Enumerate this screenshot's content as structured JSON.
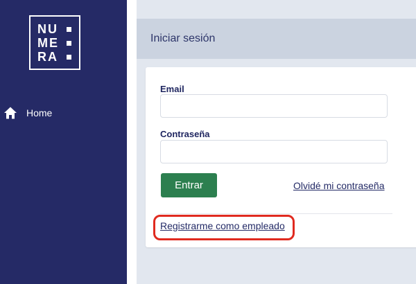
{
  "sidebar": {
    "logo": {
      "line1": "NU",
      "line2": "ME",
      "line3": "RA"
    },
    "nav": [
      {
        "label": "Home",
        "icon": "home-icon"
      }
    ]
  },
  "header": {
    "title": "Iniciar sesión"
  },
  "form": {
    "email_label": "Email",
    "email_value": "",
    "password_label": "Contraseña",
    "password_value": "",
    "submit_label": "Entrar",
    "forgot_label": "Olvidé mi contraseña",
    "register_label": "Registrarme como empleado"
  },
  "colors": {
    "sidebar": "#252a66",
    "header": "#cbd3e0",
    "background": "#e2e7ef",
    "primary_button": "#2c7f4f",
    "highlight": "#e02a1f",
    "link": "#232a66"
  }
}
